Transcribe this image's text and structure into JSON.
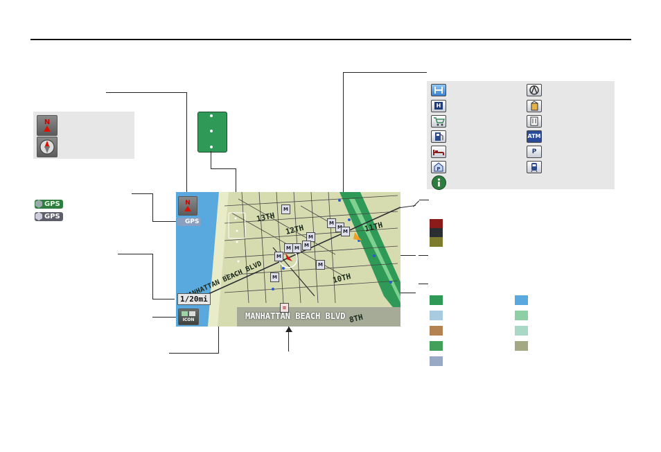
{
  "map": {
    "scale_label": "1/20mi",
    "icon_button_label": "ICON",
    "street_name": "MANHATTAN BEACH BLVD",
    "gps_badge": "GPS",
    "compass_label": "N",
    "street_labels": [
      "13TH",
      "12TH",
      "11TH",
      "10TH",
      "8TH",
      "MANHATTAN BEACH BLVD"
    ]
  },
  "gps_legend": {
    "items": [
      {
        "label": "GPS",
        "style": "filled"
      },
      {
        "label": "GPS",
        "style": "outline"
      }
    ]
  },
  "poi_legend": {
    "icons": [
      "honda-dealer-icon",
      "acura-dealer-icon",
      "hospital-icon",
      "school-icon",
      "shopping-icon",
      "restaurant-icon",
      "gas-station-icon",
      "atm-icon",
      "hotel-icon",
      "parking-icon",
      "parking-garage-icon",
      "transit-icon",
      "info-icon"
    ],
    "atm_text": "ATM",
    "hospital_text": "H",
    "parking_text": "P"
  },
  "colors": {
    "ocean": "#5aa9de",
    "land": "#d6dbb0",
    "park": "#2f9a57",
    "road_red": "#8b1a1a",
    "road_dark": "#2a2e33",
    "road_olive": "#7d7b2e",
    "legend_bg": "#e7e7e7",
    "banner": "#a6ab98"
  }
}
